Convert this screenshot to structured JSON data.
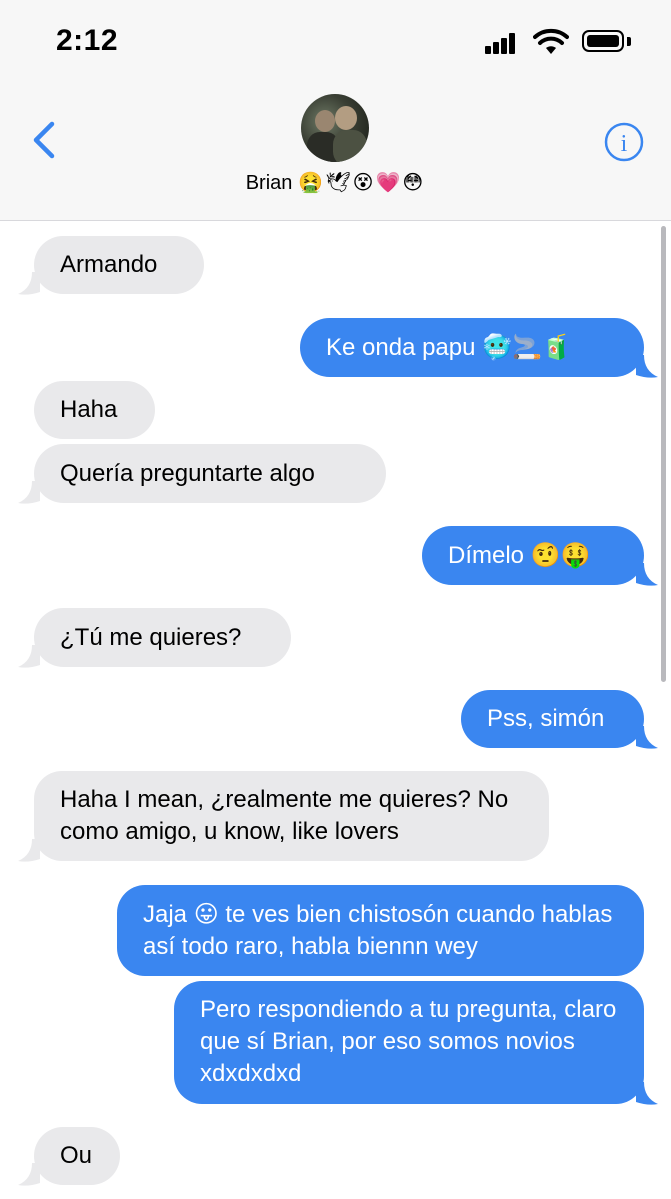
{
  "status_bar": {
    "time": "2:12"
  },
  "header": {
    "contact_name": "Brian",
    "contact_emojis": "🤮🕊😵💗😳"
  },
  "messages": [
    {
      "side": "in",
      "text": "Armando"
    },
    {
      "side": "out",
      "text": "Ke onda papu 🥶🚬🧃"
    },
    {
      "side": "in",
      "text": "Haha"
    },
    {
      "side": "in",
      "text": "Quería preguntarte algo"
    },
    {
      "side": "out",
      "text": "Dímelo 🤨🤑"
    },
    {
      "side": "in",
      "text": "¿Tú me quieres?"
    },
    {
      "side": "out",
      "text": "Pss, simón"
    },
    {
      "side": "in",
      "text": "Haha I mean, ¿realmente me quieres? No como amigo, u know, like lovers"
    },
    {
      "side": "out",
      "text": "Jaja 😛 te ves bien chistosón cuando hablas así todo raro, habla biennn wey"
    },
    {
      "side": "out",
      "text": "Pero respondiendo a tu pregunta, claro que sí Brian, por eso somos novios xdxdxdxd"
    },
    {
      "side": "in",
      "text": "Ou"
    }
  ],
  "colors": {
    "accent": "#3a86f0",
    "incoming_bubble": "#e9e9eb",
    "header_bg": "#f7f7f7"
  },
  "icons": {
    "back": "chevron-left-icon",
    "info": "info-icon"
  }
}
